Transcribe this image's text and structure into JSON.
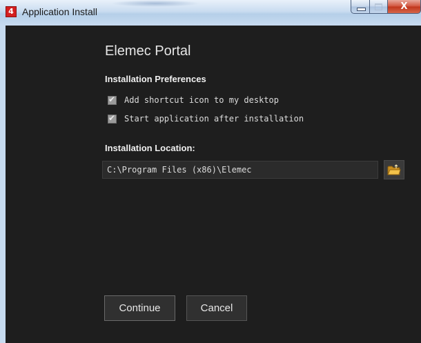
{
  "window": {
    "title": "Application Install",
    "app_icon_glyph": "4",
    "close_glyph": "X"
  },
  "main": {
    "app_title": "Elemec Portal",
    "preferences_heading": "Installation Preferences",
    "options": [
      {
        "label": "Add shortcut icon to my desktop",
        "checked": true
      },
      {
        "label": "Start application after installation",
        "checked": true
      }
    ],
    "location_heading": "Installation Location:",
    "location_value": "C:\\Program Files (x86)\\Elemec"
  },
  "actions": {
    "continue_label": "Continue",
    "cancel_label": "Cancel"
  },
  "icons": {
    "app": "app-logo-icon",
    "browse": "folder-icon",
    "checkbox": "checkmark-icon"
  },
  "colors": {
    "background": "#1e1e1e",
    "titlebar": "#c9dcf0",
    "close_button": "#c0361c",
    "folder": "#e8b43a"
  }
}
